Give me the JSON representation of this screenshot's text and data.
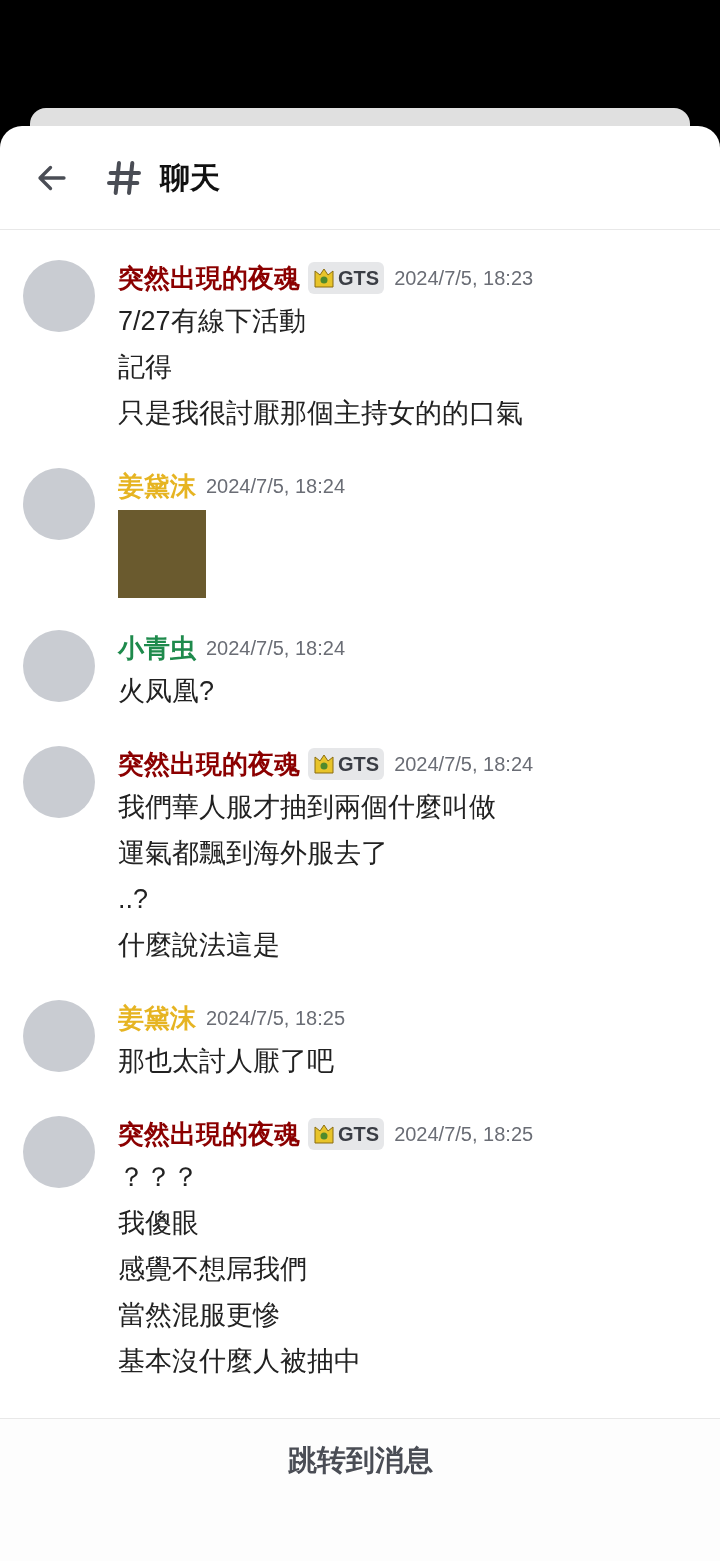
{
  "header": {
    "title": "聊天"
  },
  "messages": [
    {
      "kind": "text",
      "author": "突然出現的夜魂",
      "color": "#8b0000",
      "badge": "GTS",
      "time": "2024/7/5, 18:23",
      "lines": [
        "7/27有線下活動",
        "記得",
        "只是我很討厭那個主持女的的口氣"
      ]
    },
    {
      "kind": "sticker",
      "author": "姜黛沫",
      "color": "#e6b422",
      "time": "2024/7/5, 18:24"
    },
    {
      "kind": "text",
      "author": "小青虫",
      "color": "#1e8a4c",
      "time": "2024/7/5, 18:24",
      "lines": [
        "火凤凰?"
      ]
    },
    {
      "kind": "text",
      "author": "突然出現的夜魂",
      "color": "#8b0000",
      "badge": "GTS",
      "time": "2024/7/5, 18:24",
      "lines": [
        "我們華人服才抽到兩個什麼叫做",
        "運氣都飄到海外服去了",
        "..?",
        "什麼說法這是"
      ]
    },
    {
      "kind": "text",
      "author": "姜黛沫",
      "color": "#e6b422",
      "time": "2024/7/5, 18:25",
      "lines": [
        "那也太討人厭了吧"
      ]
    },
    {
      "kind": "text",
      "author": "突然出現的夜魂",
      "color": "#8b0000",
      "badge": "GTS",
      "time": "2024/7/5, 18:25",
      "lines": [
        "？？？",
        "我傻眼",
        "感覺不想屌我們",
        "當然混服更慘",
        "基本沒什麼人被抽中"
      ]
    }
  ],
  "jump_button": "跳转到消息"
}
